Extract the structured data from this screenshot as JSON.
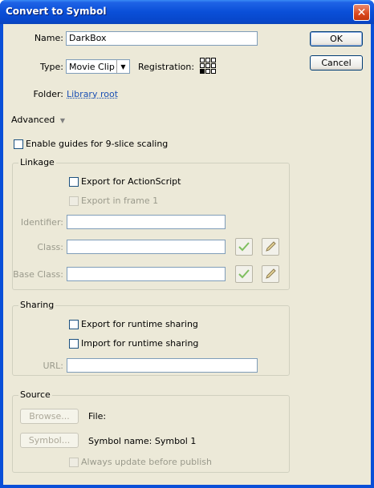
{
  "window": {
    "title": "Convert to Symbol",
    "close_glyph": "✕"
  },
  "name": {
    "label": "Name:",
    "value": "DarkBox"
  },
  "type": {
    "label": "Type:",
    "value": "Movie Clip",
    "arrow": "▼"
  },
  "registration": {
    "label": "Registration:"
  },
  "folder": {
    "label": "Folder:",
    "value": "Library root"
  },
  "advanced": {
    "label": "Advanced",
    "arrow": "▼"
  },
  "nine_slice": {
    "label": "Enable guides for 9-slice scaling"
  },
  "buttons": {
    "ok": "OK",
    "cancel": "Cancel"
  },
  "linkage": {
    "title": "Linkage",
    "export_as": "Export for ActionScript",
    "export_frame1": "Export in frame 1",
    "identifier_label": "Identifier:",
    "class_label": "Class:",
    "base_class_label": "Base Class:"
  },
  "sharing": {
    "title": "Sharing",
    "export_runtime": "Export for runtime sharing",
    "import_runtime": "Import for runtime sharing",
    "url_label": "URL:"
  },
  "source": {
    "title": "Source",
    "browse_button": "Browse...",
    "file_label": "File:",
    "symbol_button": "Symbol...",
    "symbol_name_label": "Symbol name: Symbol 1",
    "always_update": "Always update before publish"
  }
}
